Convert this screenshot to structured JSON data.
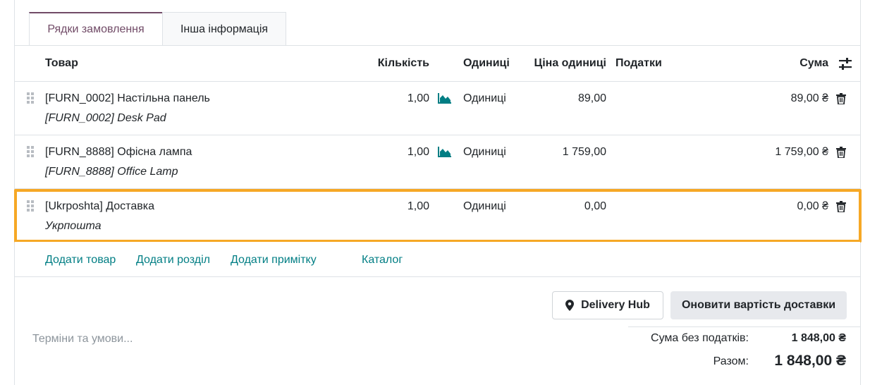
{
  "tabs": [
    {
      "label": "Рядки замовлення",
      "active": true
    },
    {
      "label": "Інша інформація",
      "active": false
    }
  ],
  "columns": {
    "product": "Товар",
    "quantity": "Кількість",
    "units": "Одиниці",
    "unit_price": "Ціна одиниці",
    "taxes": "Податки",
    "subtotal": "Сума"
  },
  "rows": [
    {
      "name": "[FURN_0002] Настільна панель",
      "description": "[FURN_0002] Desk Pad",
      "quantity": "1,00",
      "uom": "Одиниці",
      "price": "89,00",
      "taxes": "",
      "subtotal": "89,00 ₴",
      "forecast_icon": "area-chart-icon"
    },
    {
      "name": "[FURN_8888] Офісна лампа",
      "description": "[FURN_8888] Office Lamp",
      "quantity": "1,00",
      "uom": "Одиниці",
      "price": "1 759,00",
      "taxes": "",
      "subtotal": "1 759,00 ₴",
      "forecast_icon": "area-chart-icon"
    },
    {
      "name": "[Ukrposhta] Доставка",
      "description": "Укрпошта",
      "quantity": "1,00",
      "uom": "Одиниці",
      "price": "0,00",
      "taxes": "",
      "subtotal": "0,00 ₴",
      "highlighted": true
    }
  ],
  "actions": {
    "add_product": "Додати товар",
    "add_section": "Додати розділ",
    "add_note": "Додати примітку",
    "catalog": "Каталог"
  },
  "buttons": {
    "delivery_hub": "Delivery Hub",
    "update_shipping": "Оновити вартість доставки"
  },
  "terms_placeholder": "Терміни та умови...",
  "totals": {
    "untaxed_label": "Сума без податків:",
    "untaxed_value": "1 848,00 ₴",
    "total_label": "Разом:",
    "total_value": "1 848,00 ₴"
  },
  "colors": {
    "accent": "#714b67",
    "link": "#017e84",
    "highlight": "#f6a825",
    "chart_icon": "#017e84"
  }
}
